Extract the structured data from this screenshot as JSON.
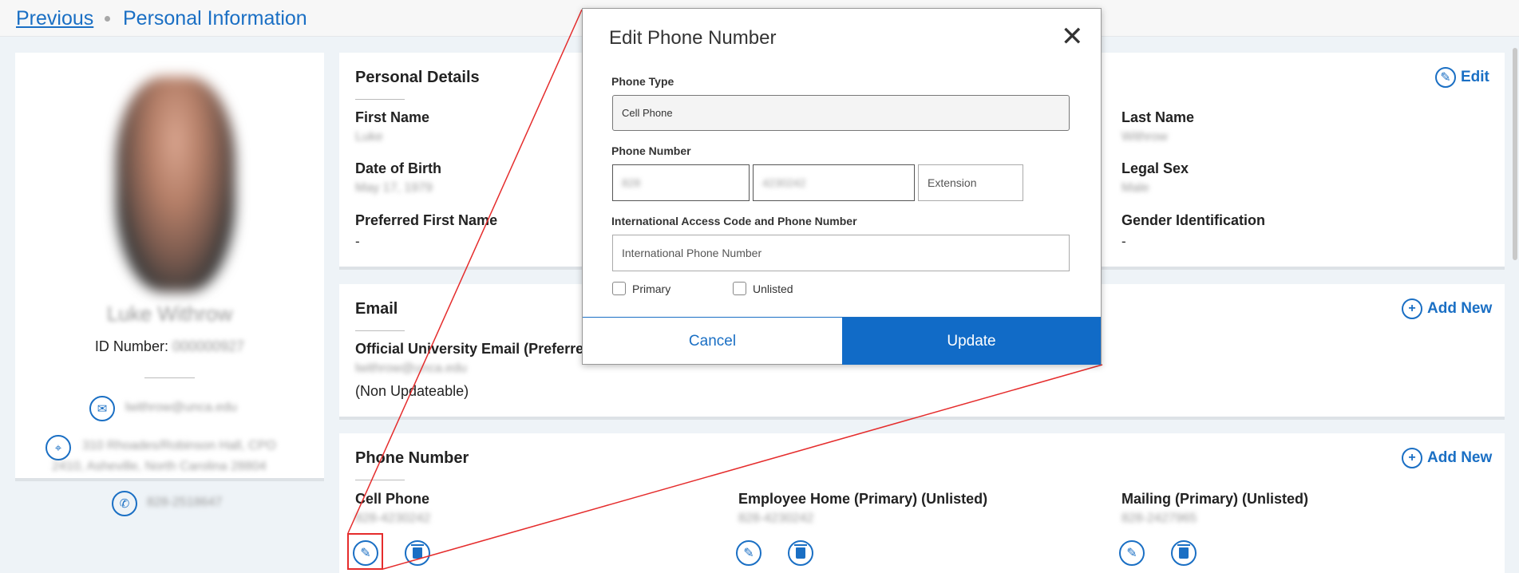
{
  "breadcrumb": {
    "previous": "Previous",
    "current": "Personal Information"
  },
  "profile": {
    "name": "Luke Withrow",
    "id_label": "ID Number:",
    "id_value": "000000927",
    "email": "lwithrow@unca.edu",
    "address_line1": "310 Rhoades/Robinson Hall, CPO",
    "address_line2": "2410, Asheville, North Carolina 28804",
    "phone": "828-2518647"
  },
  "personal_details": {
    "title": "Personal Details",
    "edit_label": "Edit",
    "first_name_label": "First Name",
    "first_name_value": "Luke",
    "dob_label": "Date of Birth",
    "dob_value": "May 17, 1979",
    "preferred_label": "Preferred First Name",
    "preferred_value": "-",
    "last_name_label": "Last Name",
    "last_name_value": "Withrow",
    "legal_sex_label": "Legal Sex",
    "legal_sex_value": "Male",
    "gender_label": "Gender Identification",
    "gender_value": "-"
  },
  "email_section": {
    "title": "Email",
    "add_label": "Add New",
    "official_label": "Official University Email (Preferred)",
    "official_value": "lwithrow@unca.edu",
    "note": "(Non Updateable)"
  },
  "phone_section": {
    "title": "Phone Number",
    "add_label": "Add New",
    "items": [
      {
        "label": "Cell Phone",
        "value": "828-4230242"
      },
      {
        "label": "Employee Home (Primary) (Unlisted)",
        "value": "828-4230242"
      },
      {
        "label": "Mailing (Primary) (Unlisted)",
        "value": "828-2427965"
      }
    ]
  },
  "modal": {
    "title": "Edit Phone Number",
    "close": "✕",
    "phone_type_label": "Phone Type",
    "phone_type_value": "Cell Phone",
    "phone_number_label": "Phone Number",
    "area_code": "828",
    "number": "4230242",
    "extension_placeholder": "Extension",
    "intl_label": "International Access Code and Phone Number",
    "intl_placeholder": "International Phone Number",
    "primary_label": "Primary",
    "unlisted_label": "Unlisted",
    "cancel_label": "Cancel",
    "update_label": "Update"
  },
  "colors": {
    "accent": "#1a6fc4",
    "highlight": "#e52c2c"
  },
  "icons": [
    "mail-icon",
    "location-icon",
    "phone-icon",
    "pencil-icon",
    "plus-icon",
    "trash-icon",
    "close-icon"
  ]
}
